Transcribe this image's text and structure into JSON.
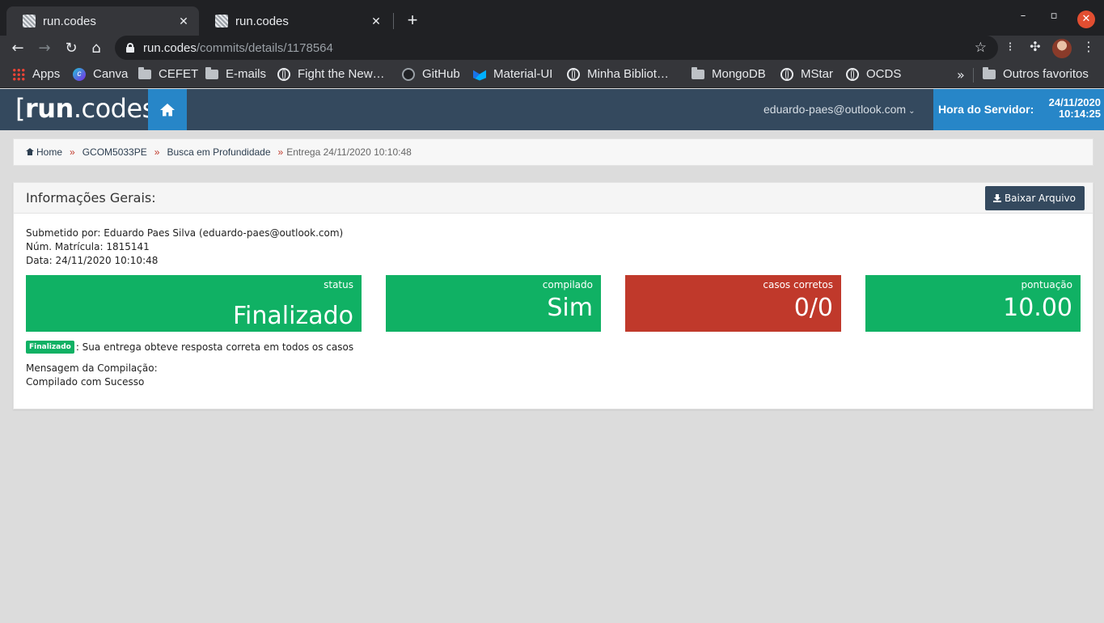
{
  "browser": {
    "tabs": [
      {
        "title": "run.codes",
        "close": "✕"
      },
      {
        "title": "run.codes",
        "close": "✕"
      }
    ],
    "new_tab": "+",
    "url_host": "run.codes",
    "url_path": "/commits/details/1178564",
    "window_controls": {
      "minimize": "–",
      "maximize": "▫",
      "close": "✕"
    },
    "bookmarks": [
      {
        "label": "Apps",
        "icon": "apps-grid-icon"
      },
      {
        "label": "Canva",
        "icon": "canva-icon"
      },
      {
        "label": "CEFET",
        "icon": "folder-icon"
      },
      {
        "label": "E-mails",
        "icon": "folder-icon"
      },
      {
        "label": "Fight the New…",
        "icon": "globe-icon"
      },
      {
        "label": "GitHub",
        "icon": "github-icon"
      },
      {
        "label": "Material-UI",
        "icon": "material-ui-icon"
      },
      {
        "label": "Minha Bibliot…",
        "icon": "globe-icon"
      },
      {
        "label": "MongoDB",
        "icon": "folder-icon"
      },
      {
        "label": "MStar",
        "icon": "globe-icon"
      },
      {
        "label": "OCDS",
        "icon": "globe-icon"
      }
    ],
    "bookmarks_more": "»",
    "other_bookmarks": "Outros favoritos"
  },
  "site": {
    "brand_open": "[",
    "brand_bold": "run",
    "brand_rest": ".codes]",
    "user_email": "eduardo-paes@outlook.com",
    "server_time_label": "Hora do Servidor:",
    "server_date": "24/11/2020",
    "server_time": "10:14:25",
    "colors": {
      "header": "#34495e",
      "accent": "#2786c8",
      "success": "#10b164",
      "danger": "#c0392b"
    }
  },
  "breadcrumb": {
    "home": "Home",
    "course": "GCOM5033PE",
    "exercise": "Busca em Profundidade",
    "current": "Entrega 24/11/2020 10:10:48",
    "separator": "»"
  },
  "panel": {
    "title": "Informações Gerais:",
    "download_label": "Baixar Arquivo",
    "submitted_by": "Submetido por: Eduardo Paes Silva (eduardo-paes@outlook.com)",
    "enrollment": "Núm. Matrícula: 1815141",
    "date": "Data: 24/11/2020 10:10:48",
    "cards": [
      {
        "label": "status",
        "value": "Finalizado"
      },
      {
        "label": "compilado",
        "value": "Sim"
      },
      {
        "label": "casos corretos",
        "value": "0/0"
      },
      {
        "label": "pontuação",
        "value": "10.00"
      }
    ],
    "result_badge": "Finalizado",
    "result_text": ": Sua entrega obteve resposta correta em todos os casos",
    "compile_title": "Mensagem da Compilação:",
    "compile_message": "Compilado com Sucesso"
  }
}
